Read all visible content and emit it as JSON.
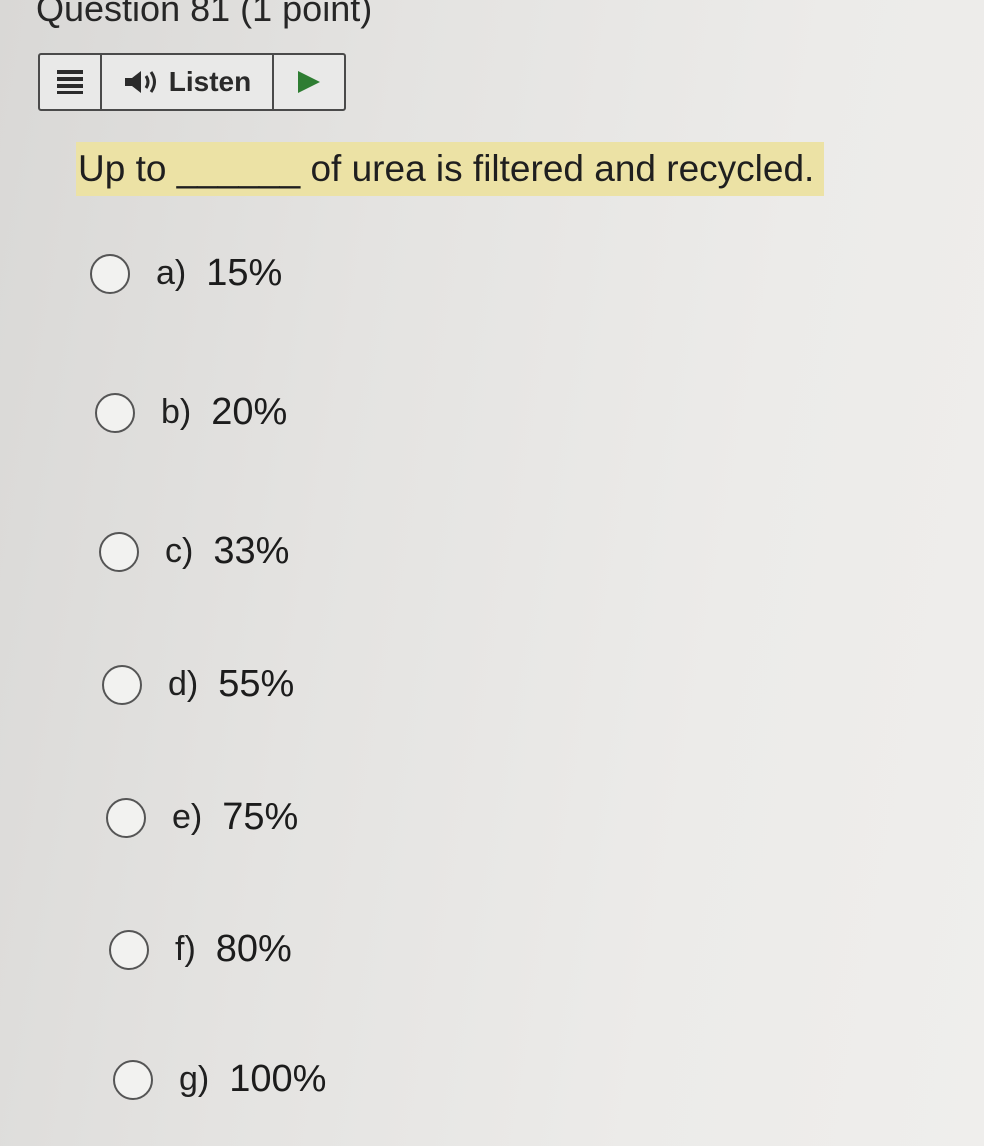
{
  "question": {
    "title": "Question 81 (1 point)",
    "text": "Up to ______ of urea is filtered and recycled."
  },
  "toolbar": {
    "menu_icon": "menu-lines-icon",
    "speaker_icon": "speaker-icon",
    "listen_label": "Listen",
    "play_icon": "play-icon",
    "play_color": "#2e7d32",
    "highlight_color": "#ece2a5"
  },
  "choices": [
    {
      "letter": "a)",
      "value": "15%"
    },
    {
      "letter": "b)",
      "value": "20%"
    },
    {
      "letter": "c)",
      "value": "33%"
    },
    {
      "letter": "d)",
      "value": "55%"
    },
    {
      "letter": "e)",
      "value": "75%"
    },
    {
      "letter": "f)",
      "value": "80%"
    },
    {
      "letter": "g)",
      "value": "100%"
    }
  ]
}
